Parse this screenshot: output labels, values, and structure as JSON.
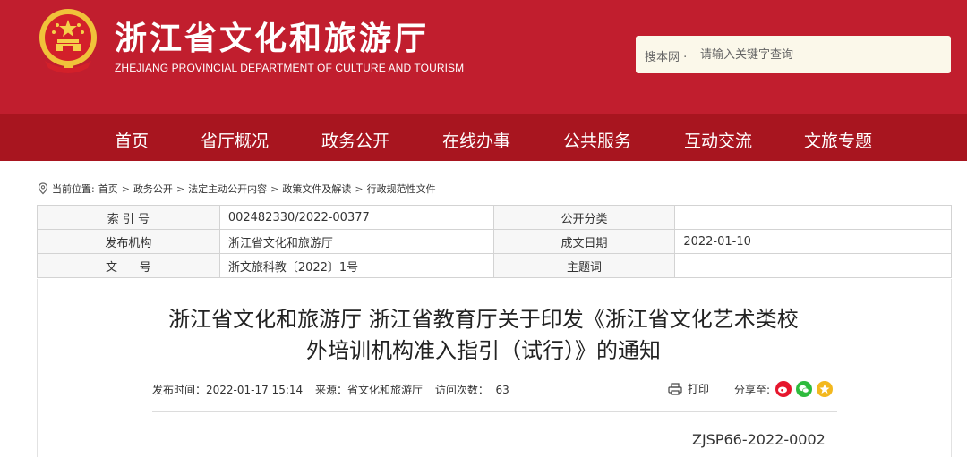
{
  "header": {
    "title": "浙江省文化和旅游厅",
    "subtitle": "ZHEJIANG PROVINCIAL DEPARTMENT OF CULTURE AND TOURISM",
    "emblem_icon": "national-emblem-icon",
    "brand_color": "#c11e2e"
  },
  "search": {
    "prefix": "搜本网 ·",
    "placeholder": "请输入关键字查询"
  },
  "nav": {
    "color": "#a8151f",
    "items": [
      "首页",
      "省厅概况",
      "政务公开",
      "在线办事",
      "公共服务",
      "互动交流",
      "文旅专题"
    ]
  },
  "breadcrumb": {
    "label": "当前位置:",
    "items": [
      "首页",
      "政务公开",
      "法定主动公开内容",
      "政策文件及解读",
      "行政规范性文件"
    ],
    "separator": ">"
  },
  "meta": {
    "index_label": "索 引 号",
    "index_value": "002482330/2022-00377",
    "category_label": "公开分类",
    "category_value": "",
    "publisher_label": "发布机构",
    "publisher_value": "浙江省文化和旅游厅",
    "date_label": "成文日期",
    "date_value": "2022-01-10",
    "docno_label": "文      号",
    "docno_value": "浙文旅科教〔2022〕1号",
    "subject_label": "主题词",
    "subject_value": ""
  },
  "article": {
    "title_line1": "浙江省文化和旅游厅 浙江省教育厅关于印发《浙江省文化艺术类校",
    "title_line2": "外培训机构准入指引（试行）》的通知",
    "publish_time": "发布时间：2022-01-17 15:14",
    "source": "来源：省文化和旅游厅",
    "visits": "访问次数：  63",
    "print_label": "打印",
    "share_label": "分享至:",
    "doc_code": "ZJSP66-2022-0002"
  }
}
